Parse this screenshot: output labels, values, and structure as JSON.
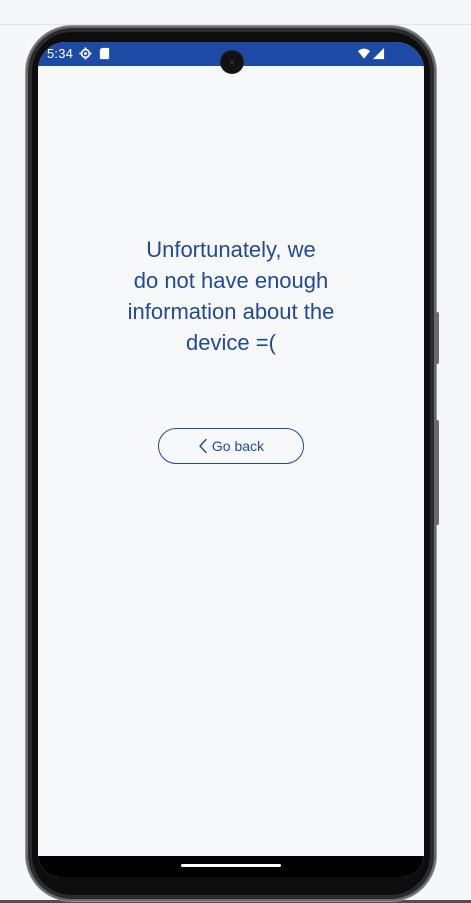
{
  "status_bar": {
    "time": "5:34",
    "background_color": "#1d4aa5",
    "icons": [
      "gear-icon",
      "sim-card-icon",
      "wifi-icon",
      "cell-signal-icon"
    ]
  },
  "main": {
    "message": "Unfortunately, we\ndo not have enough\ninformation about the\ndevice =(",
    "text_color": "#1f4a98",
    "back_button": {
      "label": "Go back",
      "icon": "chevron-left-icon"
    }
  },
  "navigation": {
    "gesture_handle": "home-indicator"
  }
}
